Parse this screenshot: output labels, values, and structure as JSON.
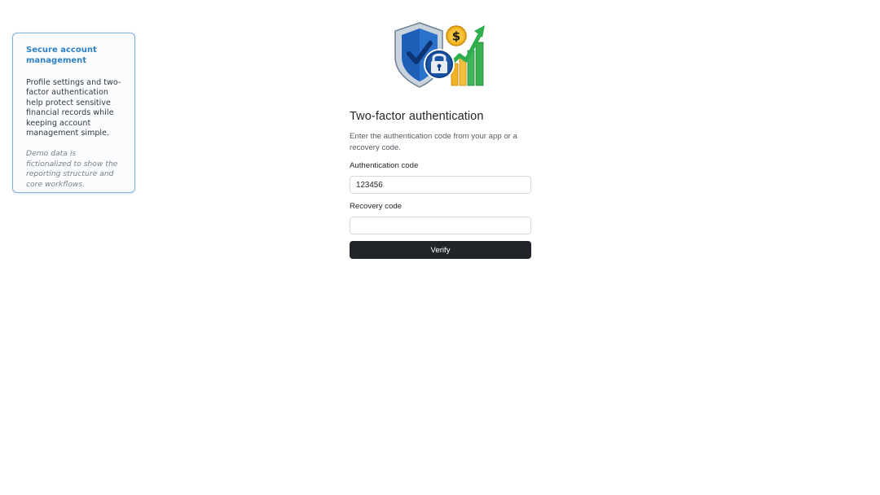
{
  "info_card": {
    "title": "Secure account management",
    "body": "Profile settings and two-factor authentication help protect sensitive financial records while keeping account management simple.",
    "note": "Demo data is fictionalized to show the reporting structure and core workflows."
  },
  "logo": {
    "icon": "shield-lock-dollar-growth-icon",
    "colors": {
      "shield_outer": "#c9d3de",
      "shield_inner": "#1e5fb8",
      "lock": "#0f3f86",
      "coin": "#f2b31c",
      "arrow": "#2fae4e",
      "bars": "#f0b323"
    }
  },
  "form": {
    "title": "Two-factor authentication",
    "description": "Enter the authentication code from your app or a recovery code.",
    "auth_code_label": "Authentication code",
    "auth_code_value": "123456",
    "recovery_label": "Recovery code",
    "recovery_value": "",
    "verify_label": "Verify"
  },
  "colors": {
    "button_bg": "#212529",
    "card_border": "#7fb0dc",
    "card_title": "#2f80c0"
  }
}
